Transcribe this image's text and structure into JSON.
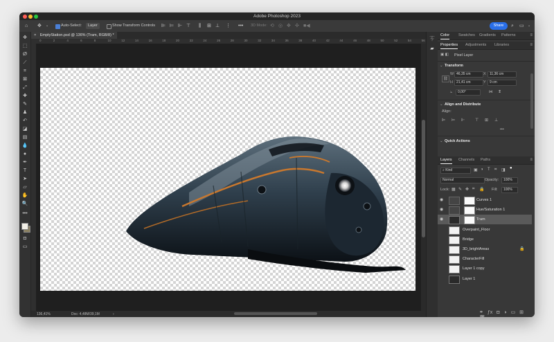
{
  "window": {
    "title": "Adobe Photoshop 2023"
  },
  "options_bar": {
    "auto_select_label": "Auto-Select:",
    "auto_select_target": "Layer",
    "show_transform_label": "Show Transform Controls",
    "mode_3d_label": "3D Mode:",
    "share_label": "Share"
  },
  "document": {
    "tab_title": "EmptyStation.psd @ 136% (Tram, RGB/8) *",
    "ruler_ticks": [
      "0",
      "2",
      "4",
      "6",
      "8",
      "10",
      "12",
      "14",
      "16",
      "18",
      "20",
      "22",
      "24",
      "26",
      "28",
      "30",
      "32",
      "34",
      "36",
      "38",
      "40",
      "42",
      "44",
      "46",
      "48",
      "50",
      "52",
      "54",
      "56"
    ],
    "zoom": "136,41%",
    "doc_size": "Doc: 4,48M/39,1M"
  },
  "top_panel": {
    "tabs": [
      "Color",
      "Swatches",
      "Gradients",
      "Patterns"
    ]
  },
  "properties_panel": {
    "tabs": [
      "Properties",
      "Adjustments",
      "Libraries"
    ],
    "layer_kind": "Pixel Layer",
    "transform_title": "Transform",
    "w_label": "W",
    "w_value": "46,35 cm",
    "x_label": "X",
    "x_value": "11,36 cm",
    "h_label": "H",
    "h_value": "21,41 cm",
    "y_label": "Y",
    "y_value": "9 cm",
    "angle_value": "0,00°",
    "align_title": "Align and Distribute",
    "align_label": "Align:",
    "more": "•••",
    "quick_actions_title": "Quick Actions"
  },
  "layers_panel": {
    "tabs": [
      "Layers",
      "Channels",
      "Paths"
    ],
    "kind_filter": "Kind",
    "blend_mode": "Normal",
    "opacity_label": "Opacity:",
    "opacity_value": "100%",
    "lock_label": "Lock:",
    "fill_label": "Fill:",
    "fill_value": "100%",
    "layers": [
      {
        "name": "Curves 1",
        "visible": true,
        "type": "adjustment",
        "selected": false
      },
      {
        "name": "Hue/Saturation 1",
        "visible": true,
        "type": "adjustment",
        "selected": false
      },
      {
        "name": "Tram",
        "visible": true,
        "type": "pixel-masked",
        "selected": true
      },
      {
        "name": "Overpaint_Floor",
        "visible": false,
        "type": "pixel",
        "selected": false
      },
      {
        "name": "Bridge",
        "visible": false,
        "type": "pixel",
        "selected": false
      },
      {
        "name": "3D_brightAreas",
        "visible": false,
        "type": "pixel",
        "selected": false,
        "locked": true
      },
      {
        "name": "CharacterFill",
        "visible": false,
        "type": "pixel",
        "selected": false
      },
      {
        "name": "Layer 1 copy",
        "visible": false,
        "type": "pixel",
        "selected": false
      },
      {
        "name": "Layer 1",
        "visible": false,
        "type": "pixel-dark",
        "selected": false
      }
    ]
  },
  "colors": {
    "share_button": "#2a6fe8",
    "selected_layer": "#5a5a5a",
    "tram_body": "#2d3e50",
    "tram_accent": "#c9782e"
  }
}
